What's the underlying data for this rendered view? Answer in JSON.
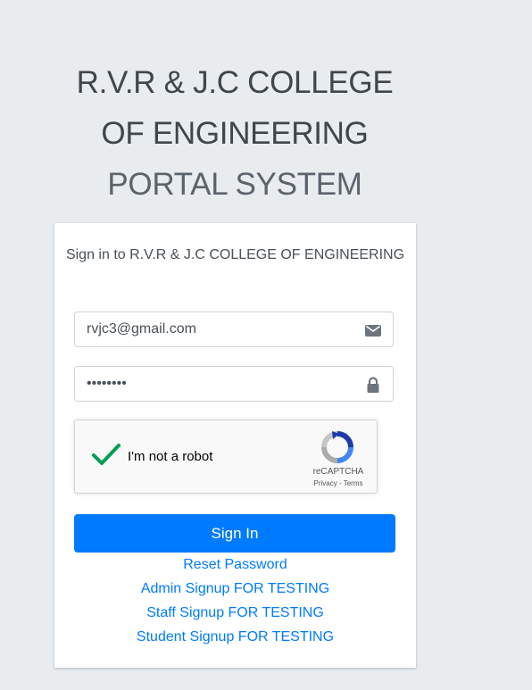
{
  "header": {
    "title_bold": "R.V.R & J.C COLLEGE OF ENGINEERING",
    "title_light": "PORTAL SYSTEM"
  },
  "card": {
    "login_msg": "Sign in to R.V.R & J.C COLLEGE OF ENGINEERING",
    "email_value": "rvjc3@gmail.com",
    "password_value": "••••••••",
    "recaptcha": {
      "label": "I'm not a robot",
      "brand": "reCAPTCHA",
      "privacy": "Privacy",
      "separator": " - ",
      "terms": "Terms",
      "checked": true
    },
    "signin_label": "Sign In",
    "links": [
      "Reset Password",
      "Admin Signup FOR TESTING",
      "Staff Signup FOR TESTING",
      "Student Signup FOR TESTING"
    ]
  },
  "colors": {
    "background": "#e9ecef",
    "primary": "#007bff",
    "text": "#495057",
    "check_green": "#009e55"
  },
  "icons": {
    "email": "envelope-icon",
    "password": "lock-icon",
    "captcha_check": "checkmark-icon",
    "captcha_logo": "recaptcha-logo-icon"
  }
}
